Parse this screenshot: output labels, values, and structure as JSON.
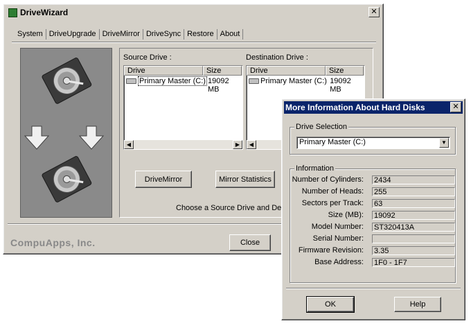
{
  "main_window": {
    "title": "DriveWizard",
    "close_glyph": "✕",
    "tabs": [
      {
        "label": "System"
      },
      {
        "label": "DriveUpgrade"
      },
      {
        "label": "DriveMirror",
        "selected": true
      },
      {
        "label": "DriveSync"
      },
      {
        "label": "Restore"
      },
      {
        "label": "About"
      }
    ],
    "source": {
      "label": "Source Drive :",
      "columns": [
        "Drive",
        "Size"
      ],
      "rows": [
        {
          "drive": "Primary Master (C:)",
          "size": "19092 MB"
        }
      ]
    },
    "destination": {
      "label": "Destination Drive :",
      "columns": [
        "Drive",
        "Size"
      ],
      "rows": [
        {
          "drive": "Primary Master (C:)",
          "size": "19092 MB"
        }
      ]
    },
    "buttons": {
      "drivemirror": "DriveMirror",
      "mirror_statistics": "Mirror Statistics",
      "close": "Close"
    },
    "status_text": "Choose a Source Drive and Destination Drive",
    "company": "CompuApps, Inc."
  },
  "dialog": {
    "title": "More Information About Hard Disks",
    "close_glyph": "✕",
    "drive_selection_label": "Drive Selection",
    "drive_selection_value": "Primary Master (C:)",
    "information_label": "Information",
    "fields": [
      {
        "label": "Number of Cylinders:",
        "value": "2434"
      },
      {
        "label": "Number of Heads:",
        "value": "255"
      },
      {
        "label": "Sectors per Track:",
        "value": "63"
      },
      {
        "label": "Size (MB):",
        "value": "19092"
      },
      {
        "label": "Model  Number:",
        "value": "ST320413A"
      },
      {
        "label": "Serial  Number:",
        "value": ""
      },
      {
        "label": "Firmware Revision:",
        "value": "3.35"
      },
      {
        "label": "Base  Address:",
        "value": "1F0 - 1F7"
      }
    ],
    "buttons": {
      "ok": "OK",
      "help": "Help"
    }
  },
  "icons": [
    "app-icon",
    "hard-disk-icon",
    "arrow-down-icon",
    "dropdown-arrow-icon",
    "scroll-left-icon",
    "scroll-right-icon"
  ],
  "colors": {
    "title_active": "#0a246a",
    "face": "#d4d0c8",
    "image_panel": "#8a8a8a"
  }
}
